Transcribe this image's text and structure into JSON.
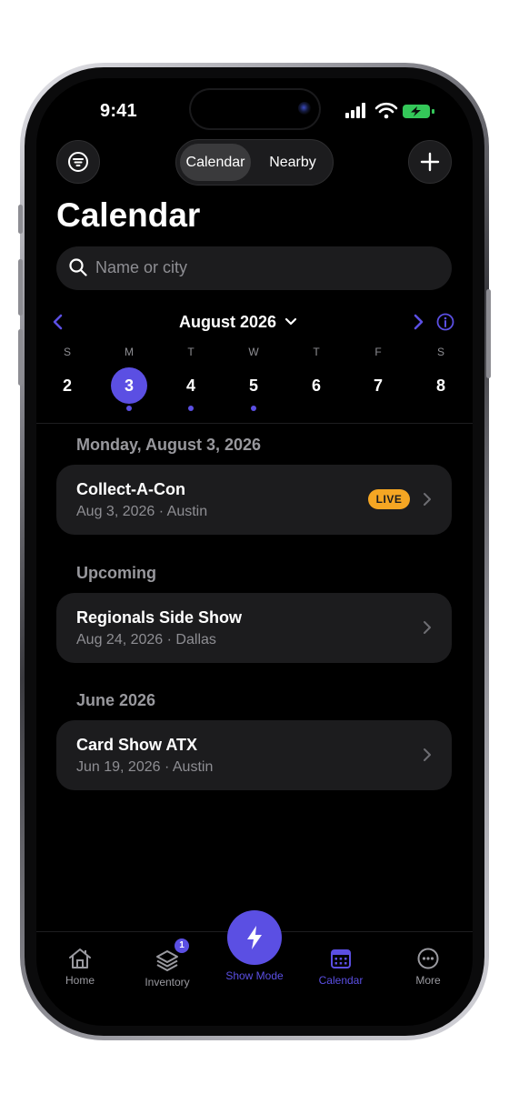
{
  "status": {
    "time": "9:41"
  },
  "header": {
    "segments": {
      "calendar": "Calendar",
      "nearby": "Nearby"
    },
    "title": "Calendar"
  },
  "search": {
    "placeholder": "Name or city"
  },
  "month": {
    "label": "August 2026"
  },
  "week": {
    "letters": [
      "S",
      "M",
      "T",
      "W",
      "T",
      "F",
      "S"
    ],
    "days": [
      "2",
      "3",
      "4",
      "5",
      "6",
      "7",
      "8"
    ],
    "selected_index": 1,
    "event_dot_indexes": [
      1,
      2,
      3
    ]
  },
  "sections": [
    {
      "heading": "Monday, August 3, 2026",
      "events": [
        {
          "title": "Collect-A-Con",
          "date": "Aug 3, 2026",
          "city": "· Austin",
          "badge": "LIVE"
        }
      ]
    },
    {
      "heading": "Upcoming",
      "events": [
        {
          "title": "Regionals Side Show",
          "date": "Aug 24, 2026",
          "city": "· Dallas"
        }
      ]
    },
    {
      "heading": "June 2026",
      "events": [
        {
          "title": "Card Show ATX",
          "date": "Jun 19, 2026",
          "city": "· Austin"
        }
      ]
    }
  ],
  "tabbar": {
    "home": "Home",
    "inventory": "Inventory",
    "inventory_badge": "1",
    "show_mode": "Show Mode",
    "calendar": "Calendar",
    "more": "More"
  },
  "colors": {
    "accent": "#5b4fe3",
    "live": "#f5a623",
    "card": "#1c1c1e",
    "background": "#000000"
  },
  "icons": [
    "filter-icon",
    "plus-icon",
    "search-icon",
    "chevron-left-icon",
    "chevron-down-icon",
    "chevron-right-icon",
    "info-icon",
    "home-icon",
    "layers-icon",
    "bolt-icon",
    "calendar-icon",
    "more-icon"
  ]
}
